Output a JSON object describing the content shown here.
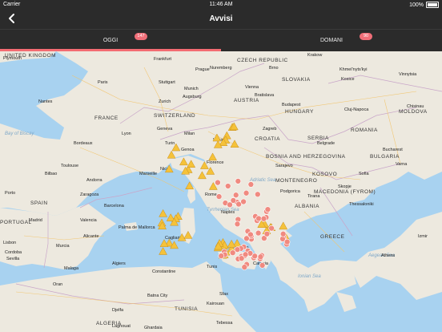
{
  "status": {
    "carrier": "Carrier",
    "time": "11:46 AM",
    "battery": "100%"
  },
  "nav": {
    "title": "Avvisi"
  },
  "tabs": [
    {
      "label": "OGGI",
      "badge": "147"
    },
    {
      "label": "DOMANI",
      "badge": "90"
    }
  ],
  "colors": {
    "bar": "#2b2b2b",
    "accent": "#f46c72",
    "sea": "#a8d2f0",
    "land": "#ede9df",
    "warning": "#f5c23a",
    "danger": "#f08a80"
  },
  "countries": [
    "UNITED KINGDOM",
    "CZECH REPUBLIC",
    "SLOVAKIA",
    "AUSTRIA",
    "HUNGARY",
    "ROMANIA",
    "MOLDOVA",
    "FRANCE",
    "SWITZERLAND",
    "CROATIA",
    "SERBIA",
    "BULGARIA",
    "BOSNIA AND HERZEGOVINA",
    "MONTENEGRO",
    "KOSOVO",
    "ALBANIA",
    "MACEDONIA (FYROM)",
    "GREECE",
    "SPAIN",
    "PORTUGAL",
    "TUNISIA",
    "ALGERIA"
  ],
  "cities": [
    "Plymouth",
    "Frankfurt",
    "Prague",
    "Krakow",
    "Khmel'nyts'kyi",
    "Vinnytsia",
    "Paris",
    "Nuremberg",
    "Brno",
    "Kosice",
    "Nantes",
    "Stuttgart",
    "Augsburg",
    "Vienna",
    "Bratislava",
    "Zurich",
    "Munich",
    "Budapest",
    "Cluj-Napoca",
    "Chisinau",
    "Lyon",
    "Geneva",
    "Milan",
    "Venice",
    "Zagreb",
    "Bordeaux",
    "Turin",
    "Genoa",
    "Florence",
    "Belgrade",
    "Bucharest",
    "Toulouse",
    "Nice",
    "Marseille",
    "Sarajevo",
    "Varna",
    "Bilbao",
    "Andorra",
    "Rome",
    "Sofia",
    "Porto",
    "Zaragoza",
    "Barcelona",
    "Naples",
    "Podgorica",
    "Skopje",
    "Madrid",
    "Valencia",
    "Palma de Mallorca",
    "Cagliari",
    "Tirana",
    "Thessaloniki",
    "Lisbon",
    "Cordoba",
    "Sevilla",
    "Murcia",
    "Alicante",
    "Palermo",
    "Catania",
    "Athens",
    "Izmir",
    "Malaga",
    "Algiers",
    "Constantine",
    "Tunis",
    "Oran",
    "Sfax",
    "Batna City",
    "Djelfa",
    "Kairouan",
    "Laghouat",
    "Ghardaia",
    "Tebessa"
  ],
  "seas": [
    "Bay of Biscay",
    "Adriatic Sea",
    "Tyrrhenian Sea",
    "Aegean Sea",
    "Ionian Sea"
  ],
  "alerts": {
    "warning_count": 52,
    "danger_count": 60
  }
}
